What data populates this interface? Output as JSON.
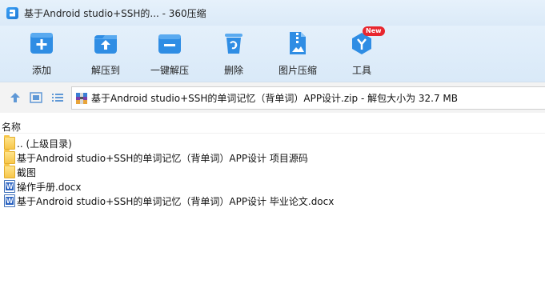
{
  "window": {
    "title": "基于Android studio+SSH的... - 360压缩"
  },
  "toolbar": {
    "items": [
      {
        "label": "添加",
        "icon": "add-icon",
        "color": "#2f8de4"
      },
      {
        "label": "解压到",
        "icon": "extract-to-icon",
        "color": "#2f8de4"
      },
      {
        "label": "一键解压",
        "icon": "one-click-extract-icon",
        "color": "#2f8de4"
      },
      {
        "label": "删除",
        "icon": "trash-icon",
        "color": "#2f8de4"
      },
      {
        "label": "图片压缩",
        "icon": "image-compress-icon",
        "color": "#2f8de4"
      },
      {
        "label": "工具",
        "icon": "tools-icon",
        "color": "#2f8de4",
        "badge": "New"
      }
    ]
  },
  "address": {
    "text": "基于Android studio+SSH的单词记忆（背单词）APP设计.zip - 解包大小为 32.7 MB"
  },
  "list": {
    "column_header": "名称",
    "rows": [
      {
        "name": ".. (上级目录)",
        "type": "folder"
      },
      {
        "name": "基于Android studio+SSH的单词记忆（背单词）APP设计 项目源码",
        "type": "folder"
      },
      {
        "name": "截图",
        "type": "folder"
      },
      {
        "name": "操作手册.docx",
        "type": "docx"
      },
      {
        "name": "基于Android studio+SSH的单词记忆（背单词）APP设计 毕业论文.docx",
        "type": "docx"
      }
    ]
  },
  "colors": {
    "accent": "#2f8de4",
    "badge": "#e8262e",
    "titlebar_bg": "#e6f1fb"
  }
}
